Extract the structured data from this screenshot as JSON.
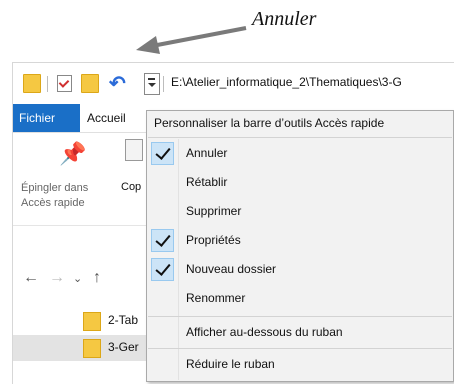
{
  "annotation": {
    "label": "Annuler"
  },
  "toolbar": {
    "path": "E:\\Atelier_informatique_2\\Thematiques\\3-G"
  },
  "tabs": {
    "file": "Fichier",
    "home": "Accueil"
  },
  "ribbon": {
    "pin_label_line1": "Épingler dans",
    "pin_label_line2": "Accès rapide",
    "copy_label": "Cop"
  },
  "files": [
    {
      "name": "2-Tab",
      "selected": false
    },
    {
      "name": "3-Ger",
      "selected": true
    }
  ],
  "menu": {
    "title": "Personnaliser la barre d’outils Accès rapide",
    "items": [
      {
        "label": "Annuler",
        "checked": true
      },
      {
        "label": "Rétablir",
        "checked": false
      },
      {
        "label": "Supprimer",
        "checked": false
      },
      {
        "label": "Propriétés",
        "checked": true
      },
      {
        "label": "Nouveau dossier",
        "checked": true
      },
      {
        "label": "Renommer",
        "checked": false
      },
      {
        "label": "Afficher au-dessous du ruban",
        "checked": false
      },
      {
        "label": "Réduire le ruban",
        "checked": false
      }
    ]
  }
}
